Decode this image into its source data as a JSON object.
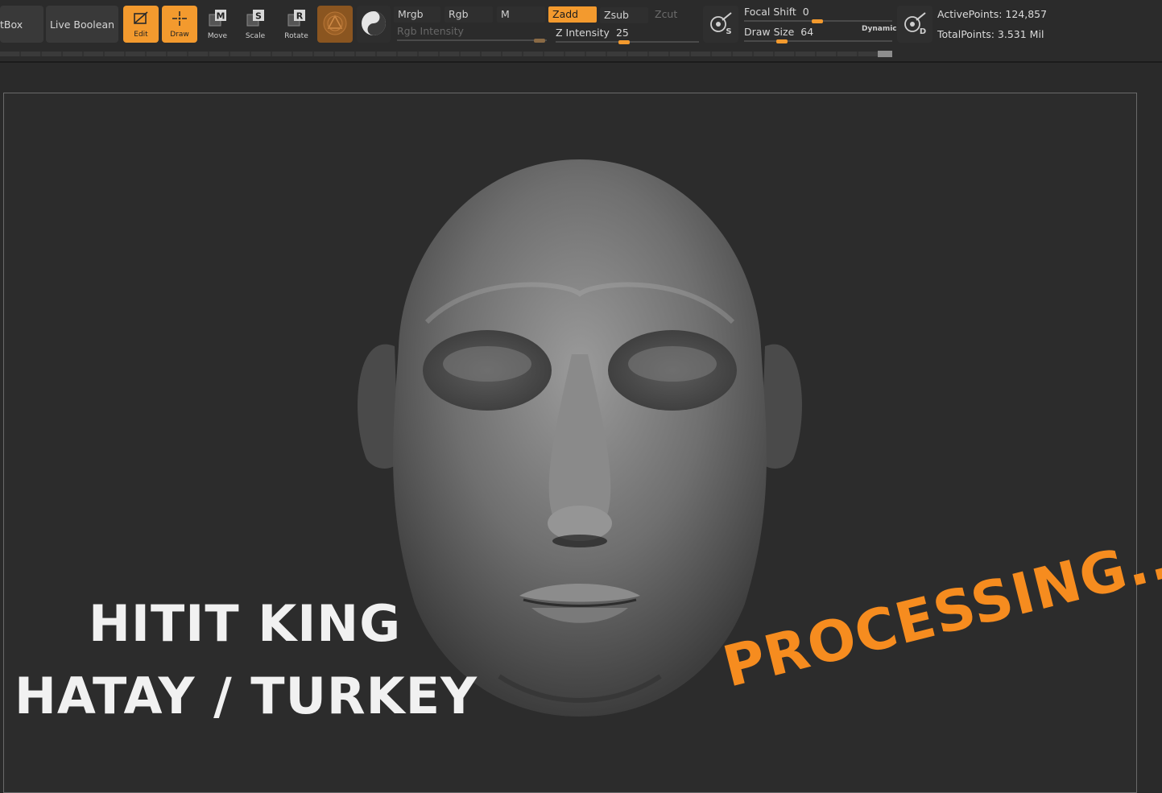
{
  "toolbar": {
    "left_tab": "tBox",
    "live_boolean": "Live Boolean",
    "tools": [
      {
        "label": "Edit",
        "icon": "edit-icon",
        "active": true
      },
      {
        "label": "Draw",
        "icon": "draw-icon",
        "active": true
      },
      {
        "label": "Move",
        "icon": "move-icon",
        "active": false
      },
      {
        "label": "Scale",
        "icon": "scale-icon",
        "active": false
      },
      {
        "label": "Rotate",
        "icon": "rotate-icon",
        "active": false
      }
    ],
    "modes": {
      "mrgb": "Mrgb",
      "rgb": "Rgb",
      "m": "M",
      "zadd": "Zadd",
      "zsub": "Zsub",
      "zcut": "Zcut"
    },
    "rgb_intensity": {
      "label": "Rgb Intensity"
    },
    "z_intensity": {
      "label": "Z Intensity",
      "value": "25"
    },
    "focal_shift": {
      "label": "Focal Shift",
      "value": "0"
    },
    "draw_size": {
      "label": "Draw Size",
      "value": "64"
    },
    "dynamic_label": "Dynamic",
    "stats": {
      "active_points": "ActivePoints: 124,857",
      "total_points": "TotalPoints: 3.531 Mil"
    },
    "accent_color": "#f39a2e"
  },
  "canvas": {
    "title_line1": "HITIT KING",
    "title_line2": "HATAY / TURKEY",
    "status": "PROCESSING....",
    "status_color": "#f68c1f"
  }
}
